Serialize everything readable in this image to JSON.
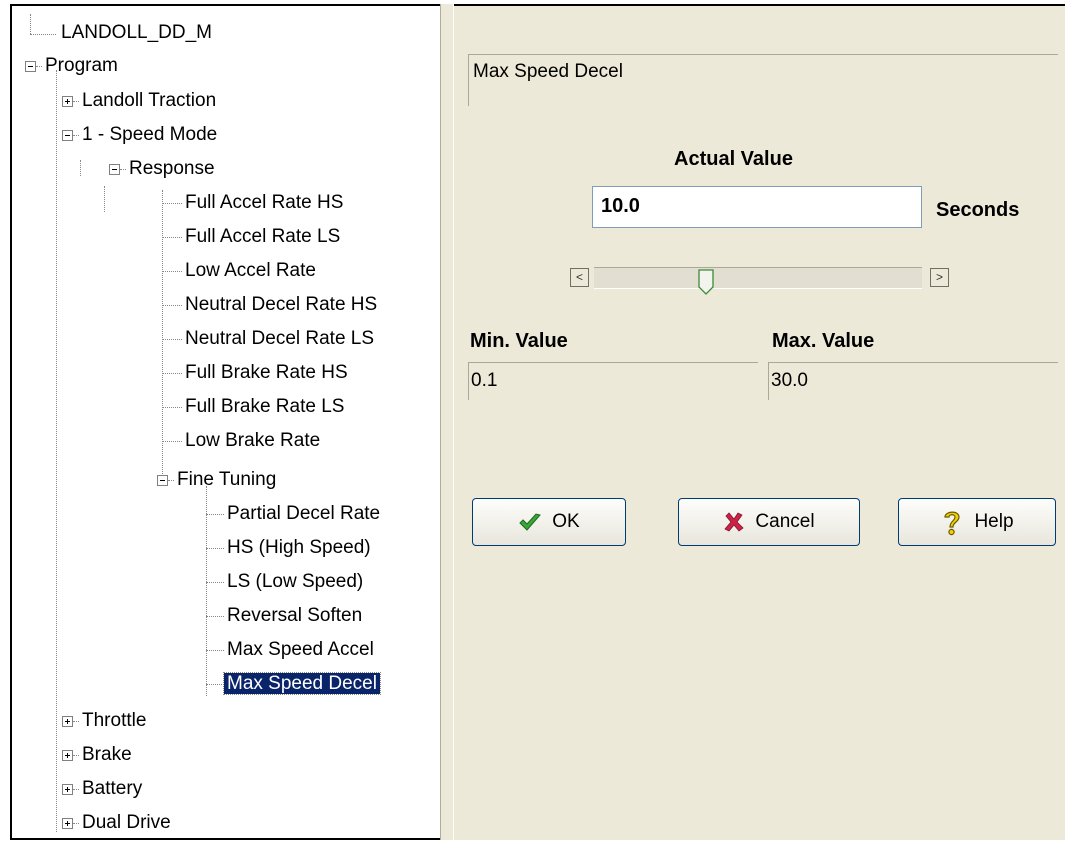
{
  "tree": {
    "root": "LANDOLL_DD_M",
    "program": "Program",
    "landoll_traction": "Landoll Traction",
    "speed_mode": "1 - Speed Mode",
    "response": "Response",
    "response_items": [
      "Full Accel Rate HS",
      "Full Accel Rate LS",
      "Low Accel Rate",
      "Neutral Decel Rate HS",
      "Neutral Decel Rate LS",
      "Full Brake Rate HS",
      "Full Brake Rate LS",
      "Low Brake Rate"
    ],
    "fine_tuning": "Fine Tuning",
    "fine_tuning_items": [
      "Partial Decel Rate",
      "HS (High Speed)",
      "LS (Low Speed)",
      "Reversal Soften",
      "Max Speed Accel",
      "Max Speed Decel"
    ],
    "bottom_items": [
      "Throttle",
      "Brake",
      "Battery",
      "Dual Drive"
    ],
    "selected": "Max Speed Decel"
  },
  "panel": {
    "param_title": "Max Speed Decel",
    "actual_label": "Actual Value",
    "actual_value": "10.0",
    "units": "Seconds",
    "slider_fraction": 0.334,
    "min_label": "Min. Value",
    "min_value": "0.1",
    "max_label": "Max. Value",
    "max_value": "30.0",
    "ok_label": "OK",
    "cancel_label": "Cancel",
    "help_label": "Help"
  },
  "colors": {
    "selection": "#0a246a",
    "panel_bg": "#ece9d8",
    "ok_check": "#3aa53a",
    "cancel_x": "#cc2244",
    "help_q": "#f0d000"
  }
}
